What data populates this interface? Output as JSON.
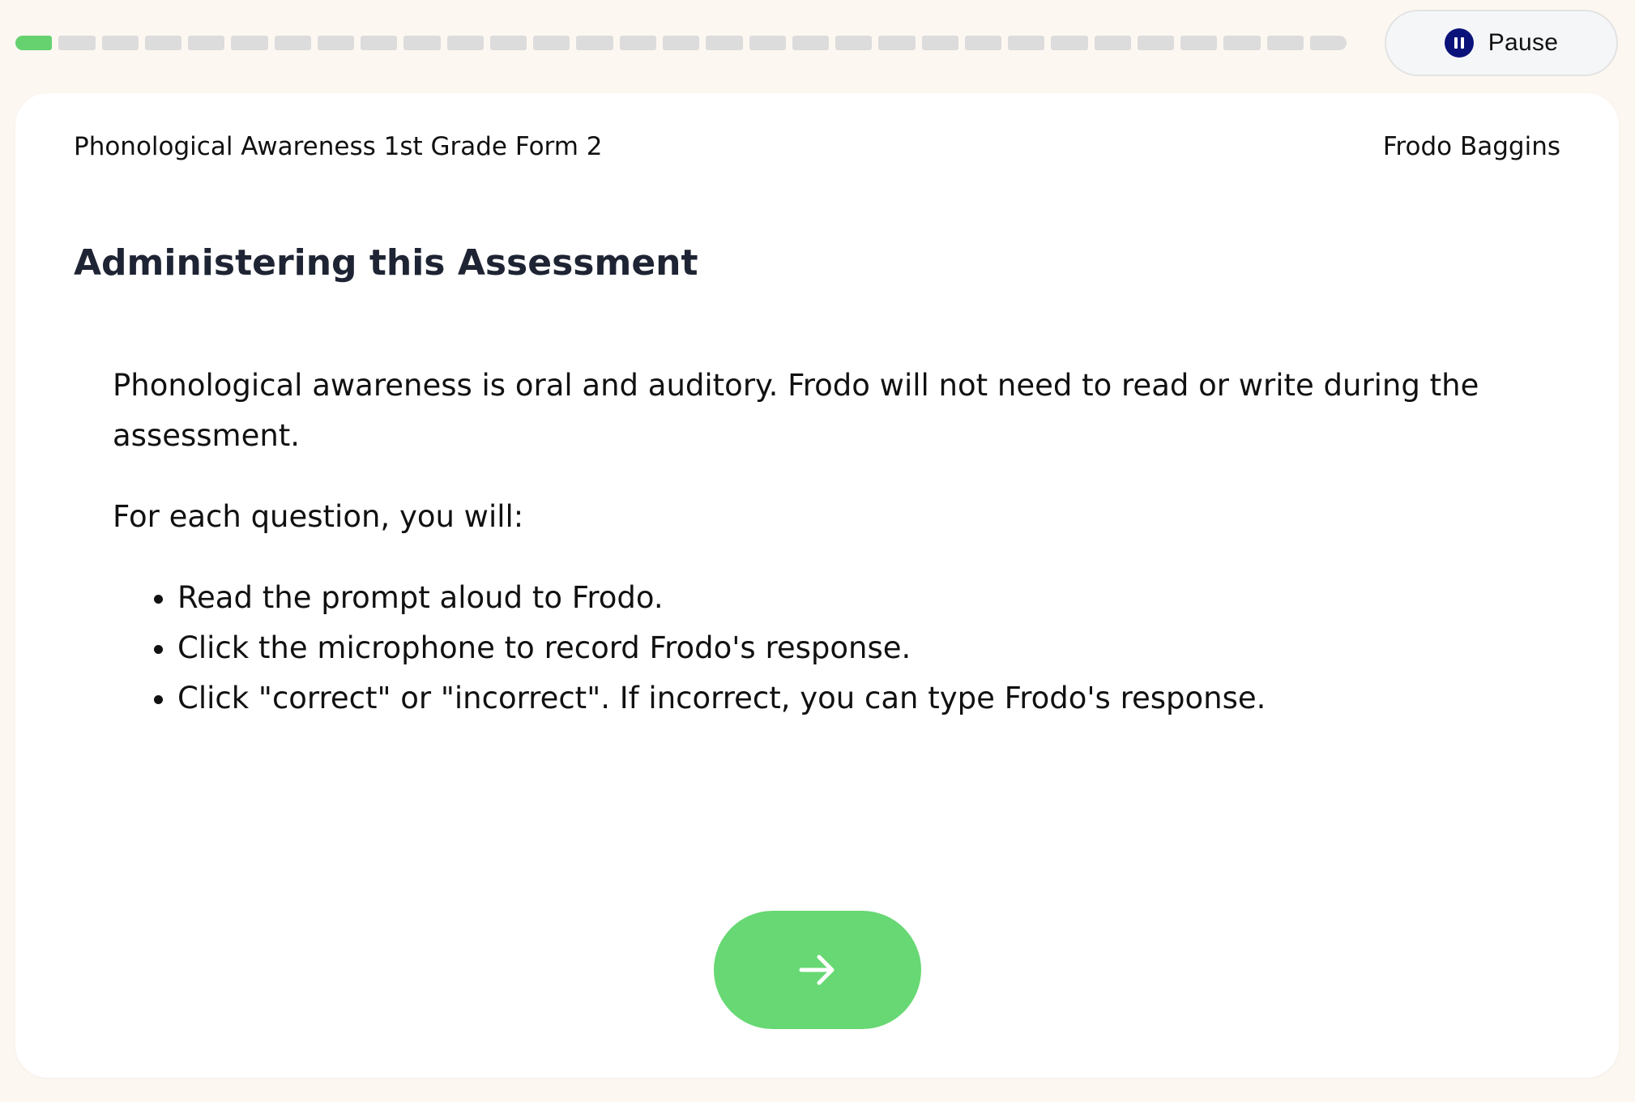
{
  "progress": {
    "total_steps": 31,
    "completed_steps": 1,
    "done_color": "#65d26f",
    "todo_color": "#dcdcdc"
  },
  "pause_button": {
    "label": "Pause",
    "icon": "pause-icon",
    "icon_color": "#0b137a"
  },
  "header": {
    "assessment_name": "Phonological Awareness 1st Grade Form 2",
    "student_name": "Frodo Baggins"
  },
  "main": {
    "title": "Administering this Assessment",
    "intro": "Phonological awareness is oral and auditory. Frodo will not need to read or write during the assessment.",
    "list_lead": "For each question, you will:",
    "steps": [
      "Read the prompt aloud to Frodo.",
      "Click the microphone to record Frodo's response.",
      "Click \"correct\" or \"incorrect\". If incorrect, you can type Frodo's response."
    ]
  },
  "next_button": {
    "icon": "arrow-right-icon",
    "color": "#67d873"
  }
}
